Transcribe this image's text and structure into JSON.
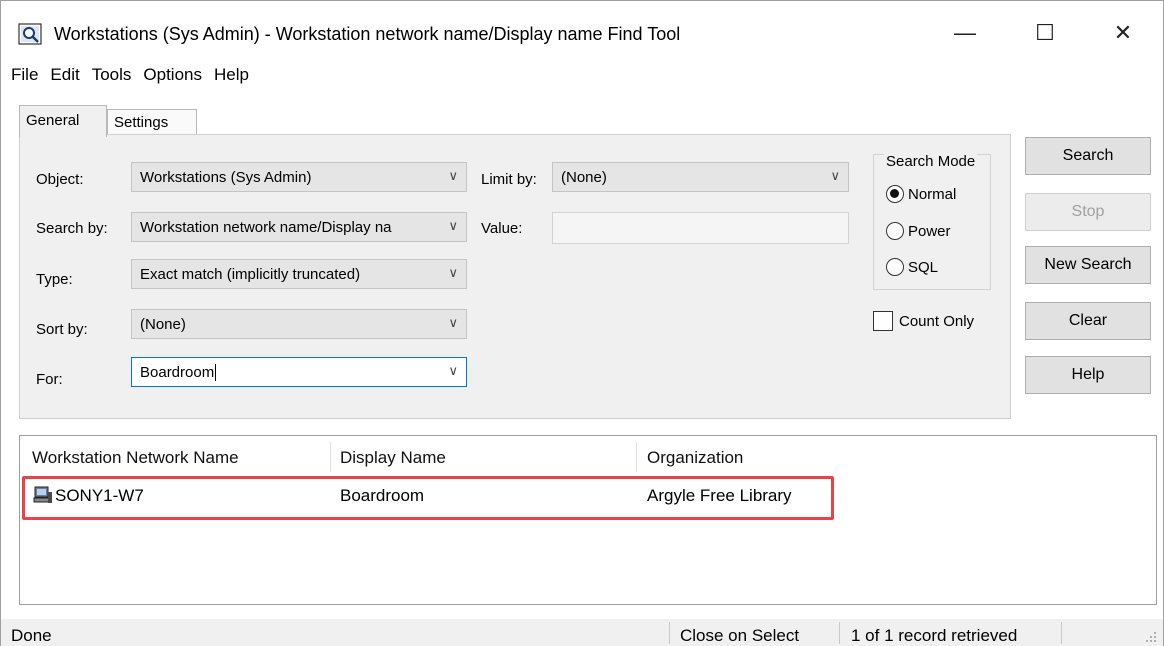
{
  "window": {
    "title": "Workstations (Sys Admin) - Workstation network name/Display name Find Tool",
    "icons": [
      "find-tool-icon",
      "minimize-icon",
      "maximize-icon",
      "close-icon"
    ],
    "minimize_glyph": "—",
    "maximize_glyph": "☐",
    "close_glyph": "✕"
  },
  "menu": {
    "items": [
      "File",
      "Edit",
      "Tools",
      "Options",
      "Help"
    ]
  },
  "tabs": {
    "general": "General",
    "settings": "Settings"
  },
  "form": {
    "object_label": "Object:",
    "object_value": "Workstations (Sys Admin)",
    "search_by_label": "Search by:",
    "search_by_value": "Workstation network name/Display na",
    "type_label": "Type:",
    "type_value": "Exact match (implicitly truncated)",
    "sort_by_label": "Sort by:",
    "sort_by_value": "(None)",
    "for_label": "For:",
    "for_value": "Boardroom",
    "limit_by_label": "Limit by:",
    "limit_by_value": "(None)",
    "value_label": "Value:",
    "value_value": "",
    "chevron": "∨"
  },
  "search_mode": {
    "title": "Search Mode",
    "options": [
      "Normal",
      "Power",
      "SQL"
    ],
    "selected": "Normal"
  },
  "count_only": {
    "label": "Count Only",
    "checked": false
  },
  "buttons": {
    "search": "Search",
    "stop": "Stop",
    "new_search": "New Search",
    "clear": "Clear",
    "help": "Help"
  },
  "results": {
    "columns": [
      "Workstation Network Name",
      "Display Name",
      "Organization"
    ],
    "rows": [
      {
        "network_name": "SONY1-W7",
        "display_name": "Boardroom",
        "organization": "Argyle Free Library",
        "icon": "workstation-icon"
      }
    ],
    "highlight_color": "#e5444a"
  },
  "status": {
    "left": "Done",
    "close_on_select": "Close on Select",
    "records": "1 of 1 record retrieved"
  }
}
